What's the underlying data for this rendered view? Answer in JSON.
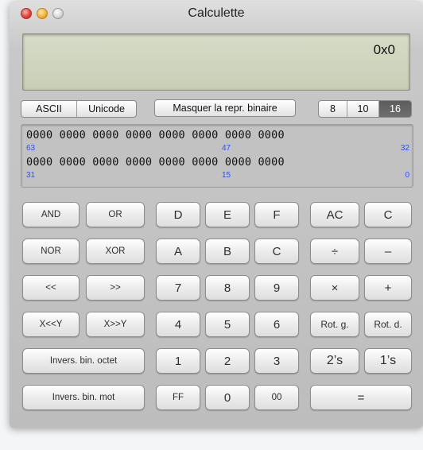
{
  "window": {
    "title": "Calculette"
  },
  "display": {
    "value": "0x0"
  },
  "mode_segment": [
    "ASCII",
    "Unicode"
  ],
  "binary_toggle": "Masquer la repr. binaire",
  "base_segment": {
    "options": [
      "8",
      "10",
      "16"
    ],
    "selected": "16"
  },
  "binary": {
    "row1_bits": "0000 0000 0000 0000 0000 0000 0000 0000",
    "row2_bits": "0000 0000 0000 0000 0000 0000 0000 0000",
    "row1_positions": [
      "63",
      "47",
      "32"
    ],
    "row2_positions": [
      "31",
      "15",
      "0"
    ]
  },
  "keys": {
    "and": "AND",
    "or": "OR",
    "nor": "NOR",
    "xor": "XOR",
    "shl": "<<",
    "shr": ">>",
    "xshly": "X<<Y",
    "xshry": "X>>Y",
    "byte_flip": "Invers. bin. octet",
    "word_flip": "Invers. bin. mot",
    "d": "D",
    "e": "E",
    "f": "F",
    "a": "A",
    "b": "B",
    "c_hex": "C",
    "n7": "7",
    "n8": "8",
    "n9": "9",
    "n4": "4",
    "n5": "5",
    "n6": "6",
    "n1": "1",
    "n2": "2",
    "n3": "3",
    "ff": "FF",
    "n0": "0",
    "n00": "00",
    "ac": "AC",
    "clear": "C",
    "divide": "÷",
    "minus": "–",
    "multiply": "×",
    "plus": "+",
    "rot_left": "Rot. g.",
    "rot_right": "Rot. d.",
    "twos": "2’s",
    "ones": "1’s",
    "equals": "="
  }
}
